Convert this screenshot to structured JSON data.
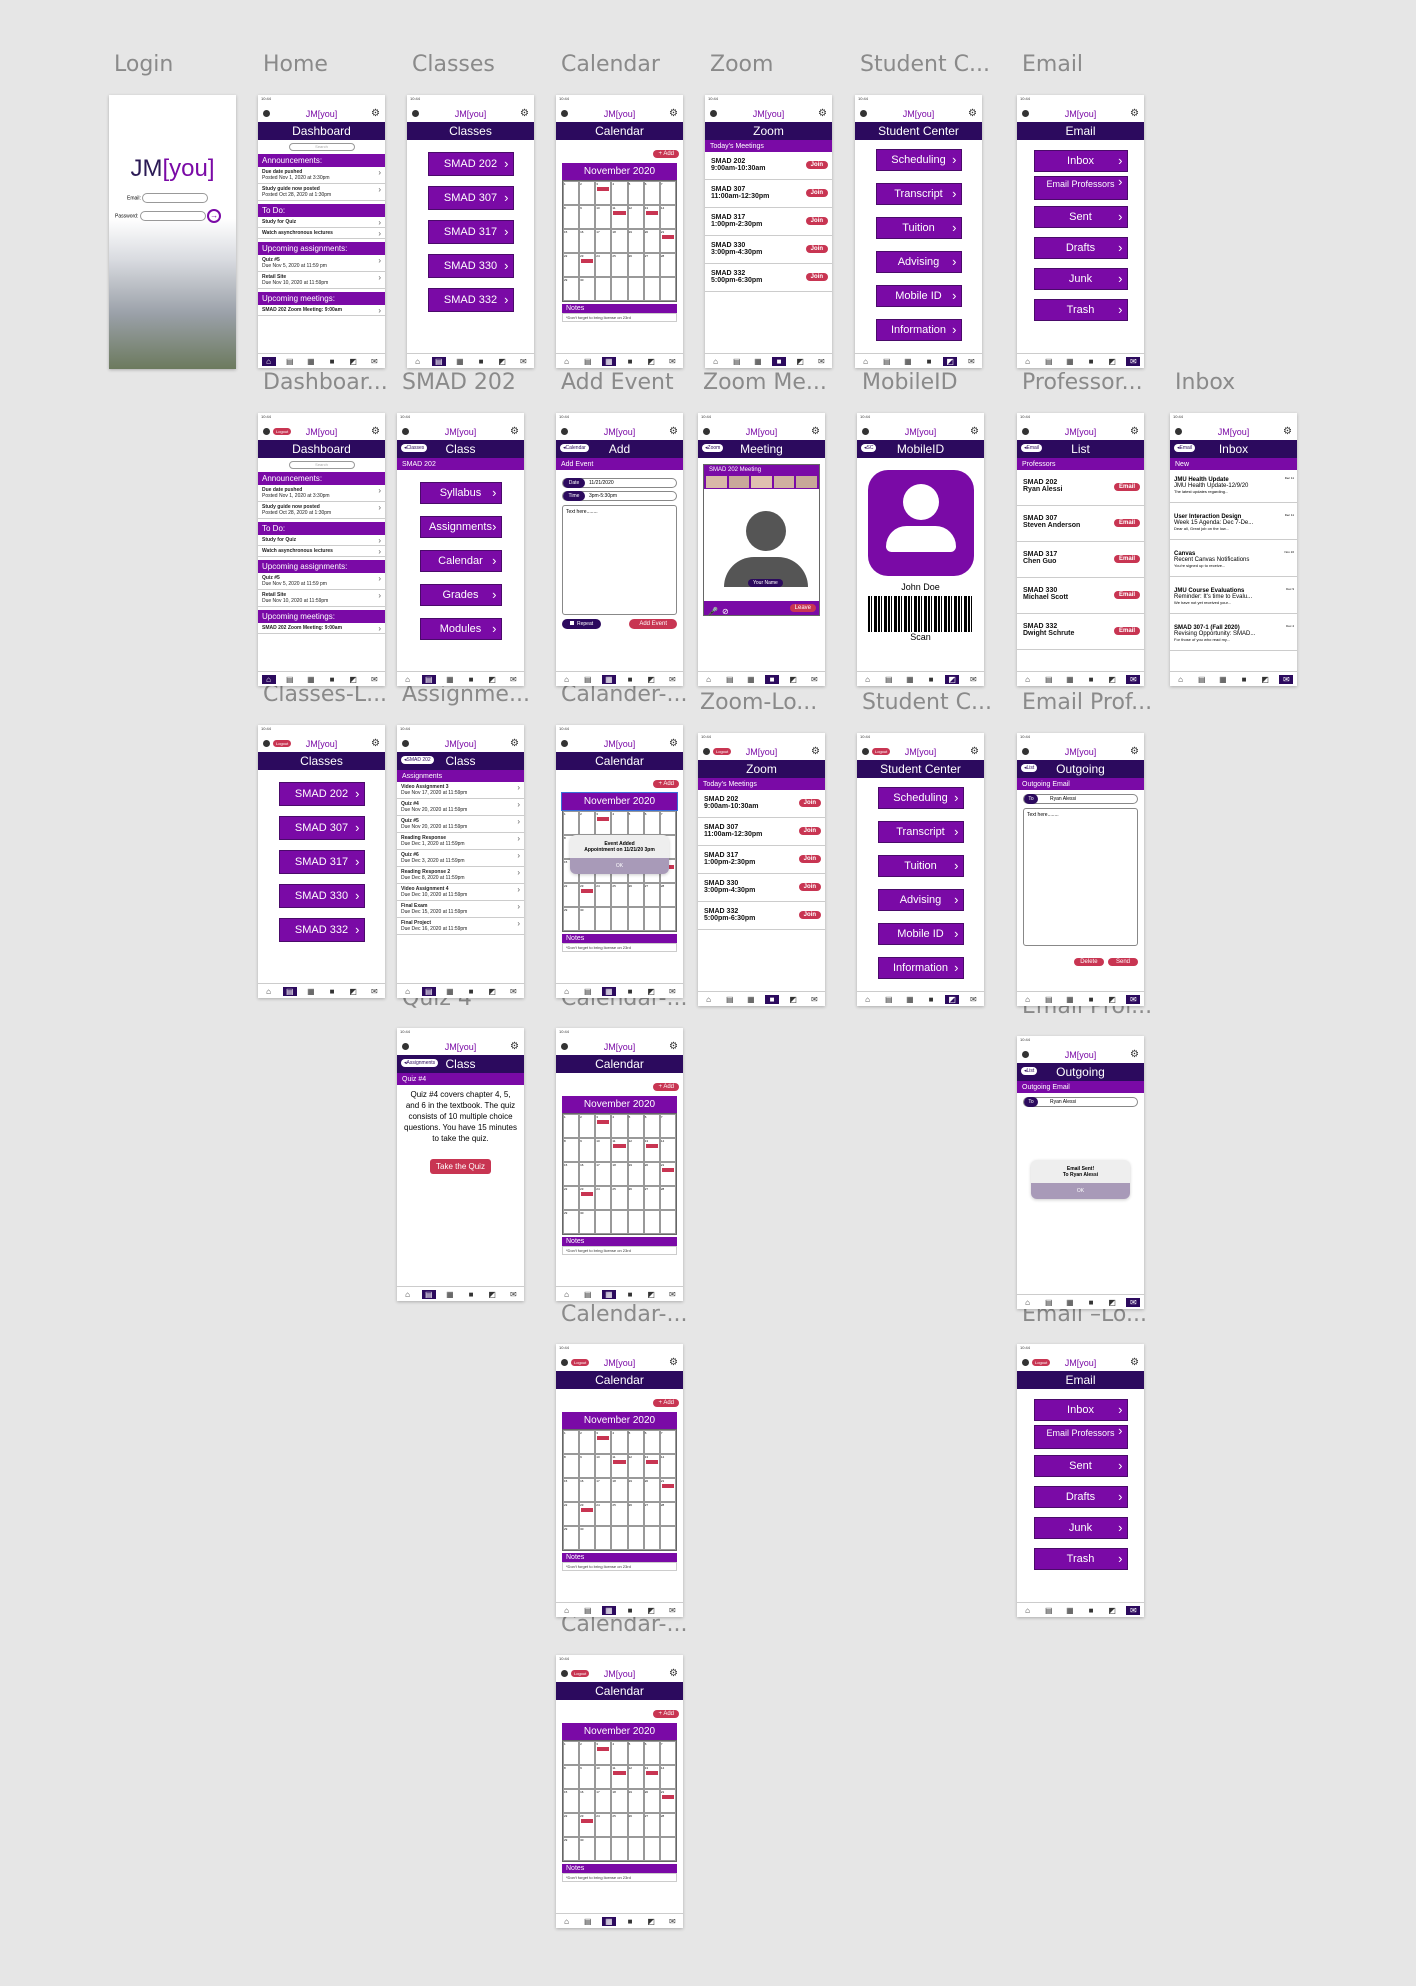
{
  "labels": {
    "r1": [
      "Login",
      "Home",
      "Classes",
      "Calendar",
      "Zoom",
      "Student C...",
      "Email"
    ],
    "r2": [
      "Dashboar...",
      "SMAD 202",
      "Add Event",
      "Zoom Me...",
      "MobileID",
      "Professor...",
      "Inbox"
    ],
    "r3": [
      "Classes-L...",
      "Assignme...",
      "Calander-...",
      "Zoom-Lo...",
      "Student C...",
      "Email Prof..."
    ],
    "r4": [
      "Quiz 4",
      "Calendar-...",
      "Email Prof..."
    ],
    "r5": [
      "Calendar-...",
      "Email –Lo..."
    ],
    "r6": [
      "Calendar-..."
    ]
  },
  "app": {
    "brand_a": "JM",
    "brand_b": "[you]",
    "time": "10:44",
    "logout": "Logout"
  },
  "login": {
    "email": "Email:",
    "password": "Password:"
  },
  "dashboard": {
    "title": "Dashboard",
    "search": "Search",
    "announcements": "Announcements:",
    "ann1": "Due date pushed",
    "ann1s": "Posted Nov 1, 2020 at 3:30pm",
    "ann2": "Study guide now posted",
    "ann2s": "Posted Oct 28, 2020 at 1:30pm",
    "todo": "To Do:",
    "todo1": "Study for Quiz",
    "todo2": "Watch asynchronous lectures",
    "upcoming": "Upcoming assignments:",
    "up1": "Quiz #5",
    "up1s": "Due Nov 5, 2020 at 11:59 pm",
    "up2": "Retail Site",
    "up2s": "Due Nov 10, 2020 at 11:59pm",
    "meetings": "Upcoming meetings:",
    "meet1": "SMAD 202 Zoom Meeting: 9:00am"
  },
  "classes": {
    "title": "Classes",
    "items": [
      "SMAD 202",
      "SMAD 307",
      "SMAD 317",
      "SMAD 330",
      "SMAD 332"
    ]
  },
  "calendar": {
    "title": "Calendar",
    "add": "+ Add",
    "month": "November 2020",
    "notes": "Notes",
    "note_text": "*Don't forget to bring license on 23rd"
  },
  "zoom": {
    "title": "Zoom",
    "sub": "Today's Meetings",
    "join": "Join",
    "meetings": [
      {
        "name": "SMAD 202",
        "time": "9:00am-10:30am"
      },
      {
        "name": "SMAD 307",
        "time": "11:00am-12:30pm"
      },
      {
        "name": "SMAD 317",
        "time": "1:00pm-2:30pm"
      },
      {
        "name": "SMAD 330",
        "time": "3:00pm-4:30pm"
      },
      {
        "name": "SMAD 332",
        "time": "5:00pm-6:30pm"
      }
    ]
  },
  "student": {
    "title": "Student Center",
    "items": [
      "Scheduling",
      "Transcript",
      "Tuition",
      "Advising",
      "Mobile ID",
      "Information"
    ]
  },
  "email": {
    "title": "Email",
    "items": [
      "Inbox",
      "Email Professors",
      "Sent",
      "Drafts",
      "Junk",
      "Trash"
    ]
  },
  "class202": {
    "back": "Classes",
    "title": "Class",
    "sub": "SMAD 202",
    "items": [
      "Syllabus",
      "Assignments",
      "Calendar",
      "Grades",
      "Modules"
    ]
  },
  "addevent": {
    "back": "Calendar",
    "title": "Add",
    "sub": "Add Event",
    "date_k": "Date",
    "date_v": "11/21/2020",
    "time_k": "Time",
    "time_v": "3pm-5:30pm",
    "text": "Text here........",
    "repeat": "Repeat",
    "add_btn": "Add Event"
  },
  "meeting": {
    "back": "Zoom",
    "title": "Meeting",
    "sub": "SMAD 202 Meeting",
    "your_name": "Your Name",
    "leave": "Leave"
  },
  "mobileid": {
    "back": "SC",
    "title": "MobileID",
    "name": "John Doe",
    "scan": "Scan"
  },
  "proflist": {
    "back": "Email",
    "title": "List",
    "sub": "Professors",
    "email_btn": "Email",
    "items": [
      {
        "c": "SMAD 202",
        "p": "Ryan Alessi"
      },
      {
        "c": "SMAD 307",
        "p": "Steven Anderson"
      },
      {
        "c": "SMAD 317",
        "p": "Chen Guo"
      },
      {
        "c": "SMAD 330",
        "p": "Michael Scott"
      },
      {
        "c": "SMAD 332",
        "p": "Dwight Schrute"
      }
    ]
  },
  "inbox": {
    "back": "Email",
    "title": "Inbox",
    "sub": "New",
    "items": [
      {
        "t": "JMU Health Update",
        "s": "JMU Health Update-12/9/20",
        "p": "The latest updates regarding...",
        "d": "Dec 11"
      },
      {
        "t": "User Interaction Design",
        "s": "Week 15 Agenda: Dec 7-De...",
        "p": "Dear all, Great job on the low...",
        "d": "Dec 11"
      },
      {
        "t": "Canvas",
        "s": "Recent Canvas Notifications",
        "p": "You're signed up to receive...",
        "d": "Nov 16"
      },
      {
        "t": "JMU Course Evaluations",
        "s": "Reminder: It's time to Evalu...",
        "p": "We have not yet received your...",
        "d": "Dec 9"
      },
      {
        "t": "SMAD 307-1 (Fall 2020)",
        "s": "Revising Opportunity: SMAD...",
        "p": "For those of you who read my...",
        "d": "Dec 4"
      }
    ]
  },
  "assignments": {
    "back": "SMAD 202",
    "title": "Class",
    "sub": "Assignments",
    "items": [
      {
        "t": "Video Assignment 3",
        "d": "Due Nov 17, 2020 at 11:59pm"
      },
      {
        "t": "Quiz #4",
        "d": "Due Nov 20, 2020 at 11:59pm"
      },
      {
        "t": "Quiz #5",
        "d": "Due Nov 20, 2020 at 11:59pm"
      },
      {
        "t": "Reading Response",
        "d": "Due Dec 1, 2020 at 11:59pm"
      },
      {
        "t": "Quiz #6",
        "d": "Due Dec 3, 2020 at 11:59pm"
      },
      {
        "t": "Reading Response 2",
        "d": "Due Dec 8, 2020 at 11:59pm"
      },
      {
        "t": "Video Assignment 4",
        "d": "Due Dec 10, 2020 at 11:59pm"
      },
      {
        "t": "Final Exam",
        "d": "Due Dec 15, 2020 at 11:59pm"
      },
      {
        "t": "Final Project",
        "d": "Due Dec 16, 2020 at 11:59pm"
      }
    ]
  },
  "event_alert": {
    "line1": "Event Added",
    "line2": "Appointment on 11/21/20 3pm",
    "ok": "OK"
  },
  "outgoing": {
    "back": "List",
    "title": "Outgoing",
    "sub": "Outgoing Email",
    "to": "To",
    "to_v": "Ryan Alessi",
    "text": "Text here........",
    "delete": "Delete",
    "send": "Send"
  },
  "quiz": {
    "back": "Assignments",
    "title": "Class",
    "sub": "Quiz #4",
    "text": "Quiz #4 covers chapter 4, 5, and 6 in the textbook. The quiz consists of 10 multiple choice questions. You have 15 minutes to take the quiz.",
    "btn": "Take the Quiz"
  },
  "sent_alert": {
    "line1": "Email Sent!",
    "line2": "To Ryan Alessi",
    "ok": "OK"
  }
}
